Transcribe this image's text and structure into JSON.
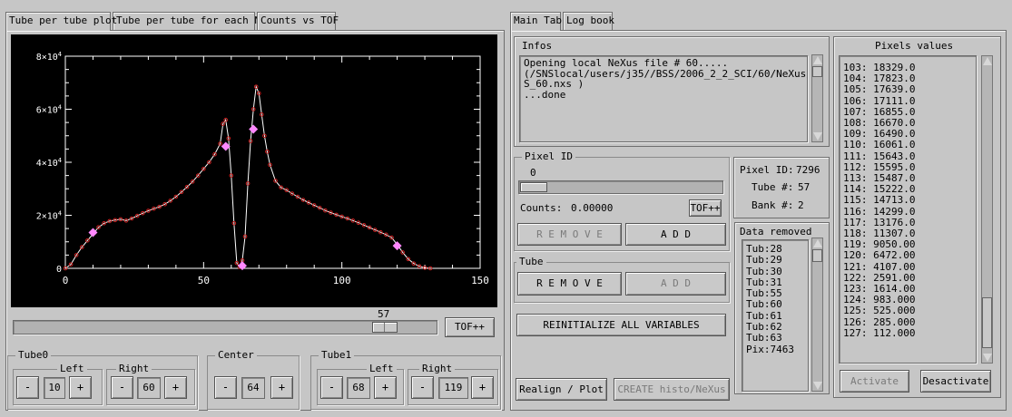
{
  "left_tabs": [
    "Tube per tube plot",
    "Tube per tube for each Nt",
    "Counts vs TOF"
  ],
  "right_tabs": [
    "Main Tab",
    "Log book"
  ],
  "plot": {
    "x_ticks": [
      "0",
      "50",
      "100",
      "150"
    ],
    "y_ticks": [
      {
        "mant": "0",
        "exp": ""
      },
      {
        "mant": "2×10",
        "exp": "4"
      },
      {
        "mant": "4×10",
        "exp": "4"
      },
      {
        "mant": "6×10",
        "exp": "4"
      },
      {
        "mant": "8×10",
        "exp": "4"
      }
    ],
    "slider_value": "57",
    "tof_button": "TOF++"
  },
  "chart_data": {
    "type": "line",
    "xlim": [
      0,
      150
    ],
    "ylim": [
      0,
      80000
    ],
    "y_tick_values": [
      0,
      20000,
      40000,
      60000,
      80000
    ],
    "x_tick_values": [
      0,
      50,
      100,
      150
    ],
    "series": [
      {
        "curve": [
          [
            0,
            0
          ],
          [
            2,
            1500
          ],
          [
            4,
            5000
          ],
          [
            6,
            8000
          ],
          [
            8,
            10500
          ],
          [
            10,
            13000
          ],
          [
            12,
            15500
          ],
          [
            14,
            17000
          ],
          [
            16,
            17800
          ],
          [
            18,
            18200
          ],
          [
            20,
            18500
          ],
          [
            22,
            18000
          ],
          [
            24,
            18800
          ],
          [
            26,
            19800
          ],
          [
            28,
            20800
          ],
          [
            30,
            21700
          ],
          [
            32,
            22500
          ],
          [
            34,
            23200
          ],
          [
            36,
            24200
          ],
          [
            38,
            25500
          ],
          [
            40,
            27000
          ],
          [
            42,
            28800
          ],
          [
            44,
            30700
          ],
          [
            46,
            32700
          ],
          [
            48,
            35000
          ],
          [
            50,
            37500
          ],
          [
            52,
            40000
          ],
          [
            54,
            43000
          ],
          [
            56,
            47000
          ],
          [
            57,
            54500
          ],
          [
            58,
            56000
          ],
          [
            59,
            49000
          ],
          [
            60,
            35000
          ],
          [
            61,
            17000
          ],
          [
            62,
            2000
          ],
          [
            63,
            500
          ],
          [
            64,
            3000
          ],
          [
            65,
            12000
          ],
          [
            66,
            32000
          ],
          [
            67,
            48000
          ],
          [
            68,
            60000
          ],
          [
            69,
            68500
          ],
          [
            70,
            66000
          ],
          [
            71,
            58000
          ],
          [
            72,
            50000
          ],
          [
            73,
            44000
          ],
          [
            74,
            39000
          ],
          [
            76,
            33000
          ],
          [
            78,
            30500
          ],
          [
            80,
            29500
          ],
          [
            82,
            28200
          ],
          [
            84,
            27000
          ],
          [
            86,
            25800
          ],
          [
            88,
            24800
          ],
          [
            90,
            23800
          ],
          [
            92,
            22800
          ],
          [
            94,
            21800
          ],
          [
            96,
            21000
          ],
          [
            98,
            20200
          ],
          [
            100,
            19500
          ],
          [
            102,
            18800
          ],
          [
            104,
            18000
          ],
          [
            106,
            17200
          ],
          [
            108,
            16300
          ],
          [
            110,
            15400
          ],
          [
            112,
            14500
          ],
          [
            114,
            13600
          ],
          [
            116,
            12700
          ],
          [
            118,
            11600
          ],
          [
            120,
            9000
          ],
          [
            122,
            6000
          ],
          [
            124,
            3500
          ],
          [
            126,
            1800
          ],
          [
            128,
            800
          ],
          [
            130,
            200
          ],
          [
            132,
            0
          ]
        ],
        "markers": [
          [
            10,
            13500
          ],
          [
            58,
            46000
          ],
          [
            64,
            1000
          ],
          [
            68,
            52500
          ],
          [
            120,
            8500
          ]
        ]
      }
    ]
  },
  "tube0": {
    "title": "Tube0",
    "left_label": "Left",
    "right_label": "Right",
    "left_value": "10",
    "right_value": "60"
  },
  "center": {
    "title": "Center",
    "value": "64"
  },
  "tube1": {
    "title": "Tube1",
    "left_label": "Left",
    "right_label": "Right",
    "left_value": "68",
    "right_value": "119"
  },
  "stepper": {
    "minus": "-",
    "plus": "+"
  },
  "infos": {
    "title": "Infos",
    "text": "Opening local NeXus file # 60.....\n(/SNSlocal/users/j35//BSS/2006_2_2_SCI/60/NeXus/BS\nS_60.nxs )\n...done"
  },
  "pixel_id": {
    "title": "Pixel ID",
    "value": "0",
    "counts_label": "Counts:",
    "counts_value": "0.00000",
    "tof_button": "TOF++",
    "remove_button": "R E M O V E",
    "add_button": "A D D"
  },
  "pixel_info": {
    "pixel_id_label": "Pixel ID:",
    "pixel_id_value": "7296",
    "tube_label": "Tube #:",
    "tube_value": "57",
    "bank_label": "Bank #:",
    "bank_value": "2"
  },
  "tube_section": {
    "title": "Tube",
    "remove_button": "R E M O V E",
    "add_button": "A D D"
  },
  "reinit_button": "REINITIALIZE ALL VARIABLES",
  "realign_button": "Realign / Plot",
  "create_button": "CREATE histo/NeXus",
  "data_removed": {
    "title": "Data removed",
    "lines": [
      "Tub:28",
      "Tub:29",
      "Tub:30",
      "Tub:31",
      "Tub:55",
      "Tub:60",
      "Tub:61",
      "Tub:62",
      "Tub:63",
      "Pix:7463"
    ]
  },
  "pixels_values": {
    "title": "Pixels values",
    "lines": [
      "103: 18329.0",
      "104: 17823.0",
      "105: 17639.0",
      "106: 17111.0",
      "107: 16855.0",
      "108: 16670.0",
      "109: 16490.0",
      "110: 16061.0",
      "111: 15643.0",
      "112: 15595.0",
      "113: 15487.0",
      "114: 15222.0",
      "115: 14713.0",
      "116: 14299.0",
      "117: 13176.0",
      "118: 11307.0",
      "119: 9050.00",
      "120: 6472.00",
      "121: 4107.00",
      "122: 2591.00",
      "123: 1614.00",
      "124: 983.000",
      "125: 525.000",
      "126: 285.000",
      "127: 112.000"
    ]
  },
  "activate_button": "Activate",
  "desactivate_button": "Desactivate",
  "colors": {
    "background": "#c6c6c6",
    "plot_bg": "#000000",
    "curve": "#ffffff",
    "point": "#cc2020",
    "marker": "#ff88ff"
  }
}
